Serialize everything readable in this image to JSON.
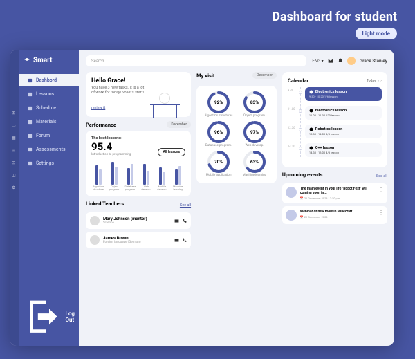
{
  "page": {
    "title": "Dashboard for student",
    "mode": "Light mode"
  },
  "brand": "Smart",
  "nav": [
    "Dashbord",
    "Lessons",
    "Schedule",
    "Materials",
    "Forum",
    "Assessments",
    "Settings"
  ],
  "logout": "Log Out",
  "search": {
    "placeholder": "Search"
  },
  "topbar": {
    "lang": "ENG",
    "user": "Grace Stanley"
  },
  "hello": {
    "title": "Hello Grace!",
    "body": "You have 3 new tasks. It is a lot of work for today! So let's start!",
    "review": "review it"
  },
  "perf": {
    "title": "Performance",
    "period": "December",
    "best_label": "The best lessons:",
    "best_num": "95.4",
    "best_sub": "Introduction to programming",
    "all": "All lessons",
    "items": [
      {
        "label": "Algoritms structures",
        "a": 28,
        "b": 22
      },
      {
        "label": "Object program.",
        "a": 33,
        "b": 26
      },
      {
        "label": "Database program.",
        "a": 24,
        "b": 30
      },
      {
        "label": "Web develop.",
        "a": 30,
        "b": 20
      },
      {
        "label": "Mobile develop.",
        "a": 25,
        "b": 18
      },
      {
        "label": "Machine learning",
        "a": 22,
        "b": 27
      }
    ]
  },
  "teachers": {
    "title": "Linked Teachers",
    "see": "See all",
    "list": [
      {
        "name": "Mary Johnson (mentor)",
        "role": "Science"
      },
      {
        "name": "James Brown",
        "role": "Foreign language (German)"
      }
    ]
  },
  "visit": {
    "title": "My visit",
    "period": "December",
    "rings": [
      {
        "pct": 92,
        "label": "Algoritms structures"
      },
      {
        "pct": 83,
        "label": "Object program."
      },
      {
        "pct": 96,
        "label": "Database program."
      },
      {
        "pct": 97,
        "label": "Web develop."
      },
      {
        "pct": 70,
        "label": "Mobile application"
      },
      {
        "pct": 63,
        "label": "Machine learning"
      }
    ]
  },
  "calendar": {
    "title": "Calendar",
    "today": "Today",
    "items": [
      {
        "time": "9.30",
        "title": "Electronics lesson",
        "sub": "9.30 - 10.20  1/6 lesson",
        "active": true
      },
      {
        "time": "11.00",
        "title": "Electronics lesson",
        "sub": "11.00 - 11.30  123 lesson",
        "active": false
      },
      {
        "time": "12.30",
        "title": "Robotics lesson",
        "sub": "12.30 - 14.00  3/6 lesson",
        "active": false
      },
      {
        "time": "14.30",
        "title": "C++ lesson",
        "sub": "14.30 - 16.00  4/6 lesson",
        "active": false
      }
    ]
  },
  "events": {
    "title": "Upcoming events",
    "see": "See all",
    "list": [
      {
        "title": "The main event in your life \"Robot Fest\" will coming soon in...",
        "date": "21 December 2023  12:30 pm"
      },
      {
        "title": "Webinar of new tools in Minecraft",
        "date": "21 December 2023"
      }
    ]
  },
  "colors": {
    "accent": "#4755a3",
    "accentLight": "#c4cae8"
  }
}
